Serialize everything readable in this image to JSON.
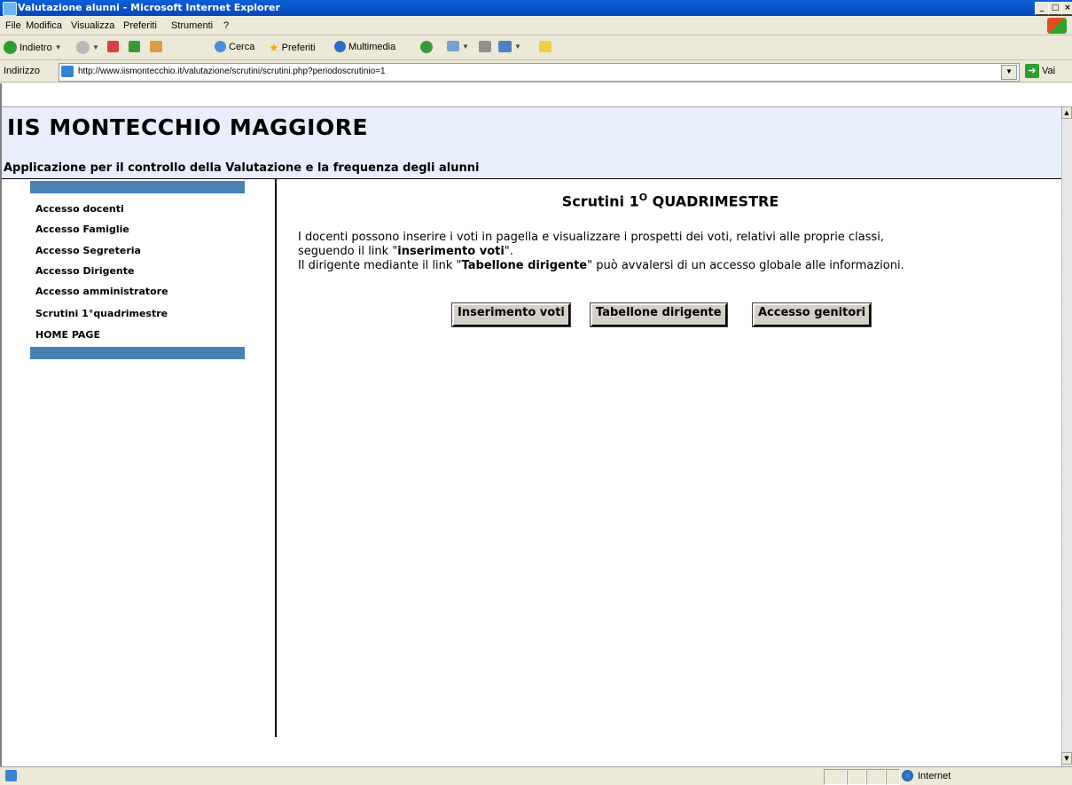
{
  "window": {
    "title": "Valutazione alunni - Microsoft Internet Explorer",
    "controls": [
      "_",
      "□",
      "×"
    ]
  },
  "menu": [
    "File",
    "Modifica",
    "Visualizza",
    "Preferiti",
    "Strumenti",
    "?"
  ],
  "toolbar": {
    "back_label": "Indietro",
    "search_label": "Cerca",
    "favorites_label": "Preferiti",
    "media_label": "Multimedia"
  },
  "address": {
    "label": "Indirizzo",
    "url": "http://www.iismontecchio.it/valutazione/scrutini/scrutini.php?periodoscrutinio=1",
    "go_label": "Vai"
  },
  "header": {
    "title": "IIS MONTECCHIO MAGGIORE",
    "subtitle": "Applicazione per il controllo della Valutazione e la frequenza degli alunni"
  },
  "sidebar": {
    "items": [
      "Accesso docenti",
      "Accesso Famiglie",
      "Accesso Segreteria",
      "Accesso Dirigente",
      "Accesso amministratore",
      "Scrutini 1°quadrimestre",
      "HOME PAGE"
    ]
  },
  "main": {
    "title_prefix": "Scrutini 1",
    "title_sup": "O",
    "title_suffix": " QUADRIMESTRE",
    "para1_line1": "I docenti possono inserire i voti in pagella e visualizzare i prospetti dei voti, relativi alle proprie classi,",
    "para1_line2_pre": "seguendo il link \"",
    "para1_line2_bold": "inserimento voti",
    "para1_line2_post": "\".",
    "para2_pre": "Il dirigente mediante il link \"",
    "para2_bold": "Tabellone dirigente",
    "para2_post": "\" può avvalersi di un accesso globale alle informazioni.",
    "buttons": [
      "Inserimento voti",
      "Tabellone dirigente",
      "Accesso genitori"
    ]
  },
  "status": {
    "zone": "Internet"
  },
  "colors": {
    "sidebar_bar": "#4682b4",
    "header_bg": "#e8eefb"
  }
}
